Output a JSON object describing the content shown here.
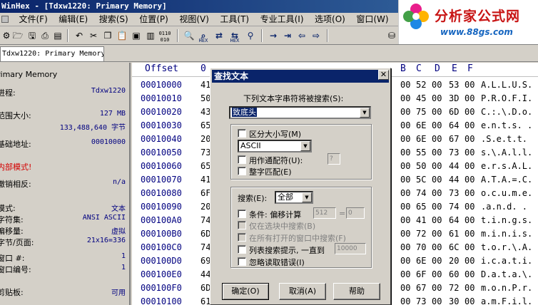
{
  "window": {
    "title": "WinHex - [Tdxw1220: Primary Memory]"
  },
  "menu": [
    {
      "label": "文件(F)"
    },
    {
      "label": "编辑(E)"
    },
    {
      "label": "搜索(S)"
    },
    {
      "label": "位置(P)"
    },
    {
      "label": "视图(V)"
    },
    {
      "label": "工具(T)"
    },
    {
      "label": "专业工具(I)"
    },
    {
      "label": "选项(O)"
    },
    {
      "label": "窗口(W)"
    },
    {
      "label": "帮助"
    }
  ],
  "toolbar": {
    "hex_label": "HEX",
    "bits_label": "0110\n010"
  },
  "logo": {
    "text": "分析家公式网",
    "url": "www.88gs.com"
  },
  "tab": {
    "label": "Tdxw1220: Primary Memory"
  },
  "info": {
    "header": "rimary Memory",
    "process_label": "进程:",
    "process_value": "Tdxw1220",
    "size_label": "范围大小:",
    "size_mb": "127 MB",
    "size_bytes": "133,488,640 字节",
    "base_label": "基础地址:",
    "base_value": "00010000",
    "readonly": "内部模式!",
    "undo_label": "撤销相反:",
    "undo_value": "n/a",
    "mode_label": "模式:",
    "mode_value": "文本",
    "charset_label": "字符集:",
    "charset_value": "ANSI ASCII",
    "offset_label": "偏移量:",
    "offset_value": "虚拟",
    "bpp_label": "字节/页面:",
    "bpp_value": "21x16=336",
    "win_label": "窗口 #:",
    "win_value": "1",
    "winno_label": "窗口编号:",
    "winno_value": "1",
    "clip_label": "剪贴板:",
    "clip_value": "可用"
  },
  "hex": {
    "offset_header": "Offset",
    "col_headers": [
      "0",
      "1",
      "2",
      "3",
      "4",
      "5",
      "6",
      "7",
      "8",
      "9",
      "A",
      "B",
      "C",
      "D",
      "E",
      "F"
    ],
    "visible_cols_left": [
      "0",
      "1"
    ],
    "visible_cols_right": [
      "B",
      "C",
      "D",
      "E",
      "F"
    ],
    "rows": [
      {
        "offset": "00010000",
        "left": [
          "41",
          "00"
        ],
        "right": [
          "00",
          "52",
          "00",
          "53",
          "00"
        ],
        "ascii": "A.L.L.U.S."
      },
      {
        "offset": "00010010",
        "left": [
          "50",
          "00"
        ],
        "right": [
          "00",
          "45",
          "00",
          "3D",
          "00"
        ],
        "ascii": "P.R.O.F.I."
      },
      {
        "offset": "00010020",
        "left": [
          "43",
          "00"
        ],
        "right": [
          "00",
          "75",
          "00",
          "6D",
          "00"
        ],
        "ascii": "C.:.\\.D.o."
      },
      {
        "offset": "00010030",
        "left": [
          "65",
          "00"
        ],
        "right": [
          "00",
          "6E",
          "00",
          "64",
          "00"
        ],
        "ascii": "e.n.t.s. ."
      },
      {
        "offset": "00010040",
        "left": [
          "20",
          "00"
        ],
        "right": [
          "00",
          "6E",
          "00",
          "67",
          "00"
        ],
        "ascii": " .S.e.t.t."
      },
      {
        "offset": "00010050",
        "left": [
          "73",
          "00"
        ],
        "right": [
          "00",
          "55",
          "00",
          "73",
          "00"
        ],
        "ascii": "s.\\.A.l.l."
      },
      {
        "offset": "00010060",
        "left": [
          "65",
          "00"
        ],
        "right": [
          "00",
          "50",
          "00",
          "44",
          "00"
        ],
        "ascii": "e.r.s.A.L."
      },
      {
        "offset": "00010070",
        "left": [
          "41",
          "00"
        ],
        "right": [
          "00",
          "5C",
          "00",
          "44",
          "00"
        ],
        "ascii": "A.T.A.=.C."
      },
      {
        "offset": "00010080",
        "left": [
          "6F",
          "00"
        ],
        "right": [
          "00",
          "74",
          "00",
          "73",
          "00"
        ],
        "ascii": "o.c.u.m.e."
      },
      {
        "offset": "00010090",
        "left": [
          "20",
          "00"
        ],
        "right": [
          "00",
          "65",
          "00",
          "74",
          "00"
        ],
        "ascii": " .a.n.d. ."
      },
      {
        "offset": "000100A0",
        "left": [
          "74",
          "00"
        ],
        "right": [
          "00",
          "41",
          "00",
          "64",
          "00"
        ],
        "ascii": "t.i.n.g.s."
      },
      {
        "offset": "000100B0",
        "left": [
          "6D",
          "00"
        ],
        "right": [
          "00",
          "72",
          "00",
          "61",
          "00"
        ],
        "ascii": "m.i.n.i.s."
      },
      {
        "offset": "000100C0",
        "left": [
          "74",
          "00"
        ],
        "right": [
          "00",
          "70",
          "00",
          "6C",
          "00"
        ],
        "ascii": "t.o.r.\\.A."
      },
      {
        "offset": "000100D0",
        "left": [
          "69",
          "00"
        ],
        "right": [
          "00",
          "6E",
          "00",
          "20",
          "00"
        ],
        "ascii": "i.c.a.t.i."
      },
      {
        "offset": "000100E0",
        "left": [
          "44",
          "00"
        ],
        "right": [
          "00",
          "6F",
          "00",
          "60",
          "00"
        ],
        "ascii": "D.a.t.a.\\."
      },
      {
        "offset": "000100F0",
        "left": [
          "6D",
          "00"
        ],
        "right": [
          "00",
          "67",
          "00",
          "72",
          "00"
        ],
        "ascii": "m.o.n.P.r."
      },
      {
        "offset": "00010100",
        "left": [
          "61",
          "00"
        ],
        "right": [
          "00",
          "73",
          "00",
          "30",
          "00"
        ],
        "ascii": "a.m.F.i.l."
      }
    ]
  },
  "dialog": {
    "title": "查找文本",
    "close": "✕",
    "prompt": "下列文本字串符将被搜索(S):",
    "search_text": "致底头",
    "case_label": "区分大小写(M)",
    "encoding": "ASCII",
    "wildcard_label": "用作通配符(U):",
    "wildcard_char": "?",
    "whole_word_label": "整字匹配(E)",
    "search_label": "搜索(E):",
    "search_dir": "全部",
    "cond_label": "条件: 偏移计算",
    "cond_a": "512",
    "cond_eq": "=",
    "cond_b": "0",
    "in_sel_label": "仅在选块中搜索(B)",
    "all_win_label": "在所有打开的窗口中搜索(F)",
    "list_label": "列表搜索提示, 一直到",
    "list_max": "10000",
    "ignore_label": "忽略读取错误(I)",
    "ok": "确定(O)",
    "cancel": "取消(A)",
    "help": "帮助"
  }
}
